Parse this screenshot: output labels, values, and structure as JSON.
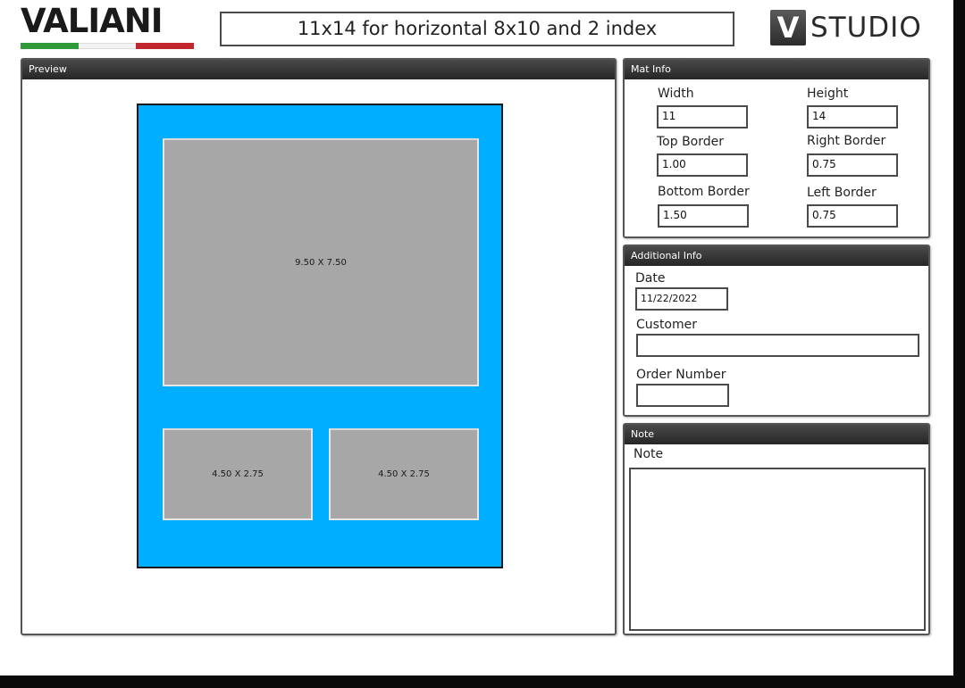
{
  "header": {
    "logo_text": "VALIANI",
    "title": "11x14 for horizontal 8x10 and 2 index",
    "studio_badge": "V",
    "studio_text": "STUDIO",
    "colors": {
      "flag_green": "#2e9a3a",
      "flag_white": "#f2f2f2",
      "flag_red": "#c1272d"
    }
  },
  "preview": {
    "title": "Preview",
    "mat_color": "#00aeff",
    "openings": [
      {
        "label": "9.50 X 7.50"
      },
      {
        "label": "4.50 X 2.75"
      },
      {
        "label": "4.50 X 2.75"
      }
    ]
  },
  "mat_info": {
    "title": "Mat Info",
    "width_label": "Width",
    "width_value": "11",
    "height_label": "Height",
    "height_value": "14",
    "top_border_label": "Top Border",
    "top_border_value": "1.00",
    "right_border_label": "Right Border",
    "right_border_value": "0.75",
    "bottom_border_label": "Bottom Border",
    "bottom_border_value": "1.50",
    "left_border_label": "Left Border",
    "left_border_value": "0.75"
  },
  "additional_info": {
    "title": "Additional Info",
    "date_label": "Date",
    "date_value": "11/22/2022",
    "customer_label": "Customer",
    "customer_value": "",
    "order_label": "Order Number",
    "order_value": ""
  },
  "note": {
    "title": "Note",
    "label": "Note",
    "value": ""
  }
}
